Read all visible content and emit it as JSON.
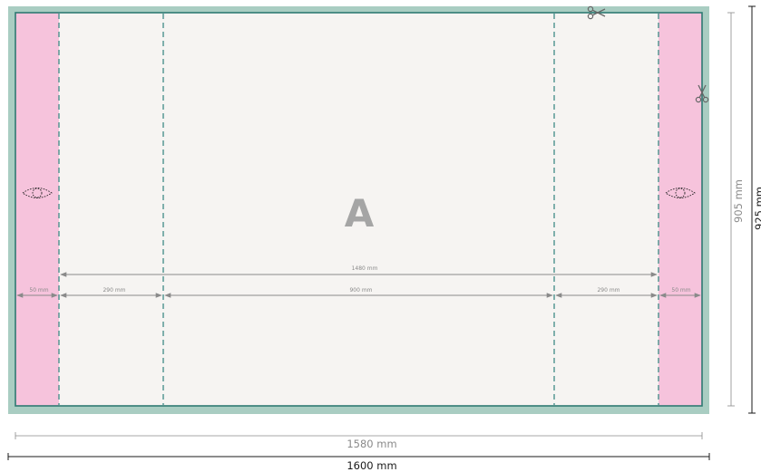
{
  "panel": {
    "letter": "A",
    "colors": {
      "outer_bleed": "#a9cdc2",
      "panel_fill": "#f6f4f2",
      "side_fill": "#f6c3dc",
      "trim_line": "#2e7a72",
      "fold_line": "#3f8a85",
      "dimension": "#8a8a8a",
      "dimension_dark": "#1a1a1a"
    }
  },
  "dimensions": {
    "inner_width": "1480 mm",
    "side_left": "50 mm",
    "fold_left": "290 mm",
    "center": "900 mm",
    "fold_right": "290 mm",
    "side_right": "50 mm",
    "trim_width": "1580 mm",
    "total_width": "1600 mm",
    "trim_height": "905 mm",
    "total_height": "925 mm"
  },
  "icons": {
    "grommet_left": "eyelet-icon",
    "grommet_right": "eyelet-icon",
    "cut_top": "scissors-icon",
    "cut_right": "scissors-icon"
  }
}
